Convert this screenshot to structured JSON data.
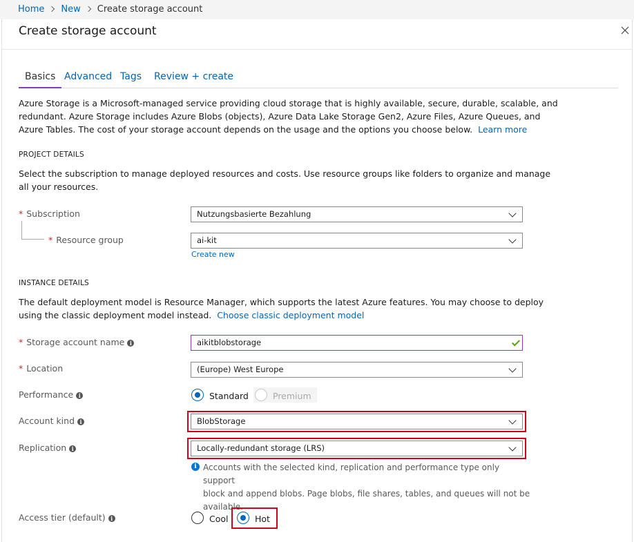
{
  "breadcrumb": {
    "home": "Home",
    "new": "New",
    "current": "Create storage account"
  },
  "blade": {
    "title": "Create storage account",
    "close_icon": "close-icon"
  },
  "tabs": [
    {
      "label": "Basics",
      "active": true
    },
    {
      "label": "Advanced",
      "active": false
    },
    {
      "label": "Tags",
      "active": false
    },
    {
      "label": "Review + create",
      "active": false
    }
  ],
  "intro": {
    "line1": "Azure Storage is a Microsoft-managed service providing cloud storage that is highly available, secure, durable, scalable, and",
    "line2": "redundant. Azure Storage includes Azure Blobs (objects), Azure Data Lake Storage Gen2, Azure Files, Azure Queues, and",
    "line3": "Azure Tables. The cost of your storage account depends on the usage and the options you choose below.",
    "learn_more": "Learn more"
  },
  "project_details": {
    "heading": "PROJECT DETAILS",
    "desc_line1": "Select the subscription to manage deployed resources and costs. Use resource groups like folders to organize and manage",
    "desc_line2": "all your resources.",
    "subscription_label": "Subscription",
    "subscription_value": "Nutzungsbasierte Bezahlung",
    "resource_group_label": "Resource group",
    "resource_group_value": "ai-kit",
    "create_new": "Create new"
  },
  "instance_details": {
    "heading": "INSTANCE DETAILS",
    "desc_line1": "The default deployment model is Resource Manager, which supports the latest Azure features. You may choose to deploy",
    "desc_line2": "using the classic deployment model instead.",
    "classic_link": "Choose classic deployment model",
    "storage_name_label": "Storage account name",
    "storage_name_value": "aikitblobstorage",
    "location_label": "Location",
    "location_value": "(Europe) West Europe",
    "performance_label": "Performance",
    "performance_options": [
      "Standard",
      "Premium"
    ],
    "performance_selected": "Standard",
    "account_kind_label": "Account kind",
    "account_kind_value": "BlobStorage",
    "replication_label": "Replication",
    "replication_value": "Locally-redundant storage (LRS)",
    "note_line1": "Accounts with the selected kind, replication and performance type only support",
    "note_line2": "block and append blobs. Page blobs, file shares, tables, and queues will not be",
    "note_line3": "available.",
    "access_tier_label": "Access tier (default)",
    "access_tier_options": [
      "Cool",
      "Hot"
    ],
    "access_tier_selected": "Hot"
  },
  "colors": {
    "link": "#0066b8",
    "active_tab_underline": "#8a3ab9",
    "required": "#c4262e",
    "highlight_box": "#d0021b",
    "valid_check": "#57a300"
  }
}
